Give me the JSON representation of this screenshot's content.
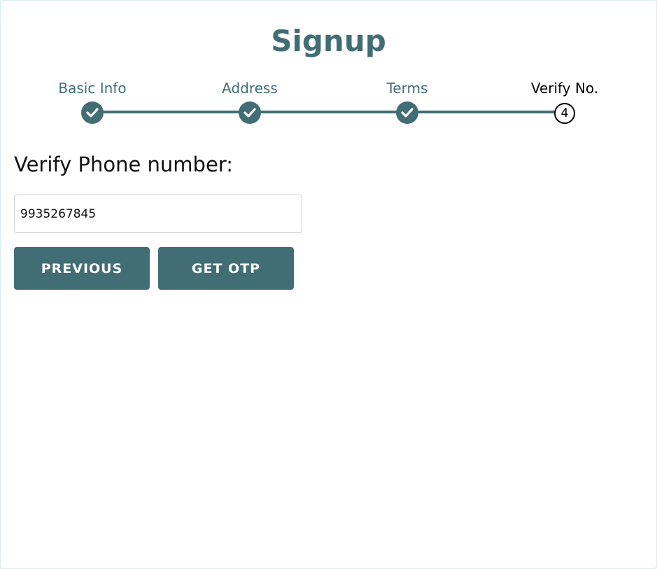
{
  "page": {
    "title": "Signup"
  },
  "stepper": {
    "steps": [
      {
        "label": "Basic Info",
        "status": "completed",
        "marker_icon": "check-icon"
      },
      {
        "label": "Address",
        "status": "completed",
        "marker_icon": "check-icon"
      },
      {
        "label": "Terms",
        "status": "completed",
        "marker_icon": "check-icon"
      },
      {
        "label": "Verify No.",
        "status": "current",
        "number": "4"
      }
    ],
    "colors": {
      "completed": "#416e74",
      "current_label": "#000000"
    }
  },
  "verify": {
    "heading": "Verify Phone number:",
    "phone_value": "9935267845"
  },
  "buttons": {
    "previous_label": "PREVIOUS",
    "get_otp_label": "GET OTP"
  },
  "colors": {
    "accent": "#416e74",
    "background": "#ffffff"
  }
}
